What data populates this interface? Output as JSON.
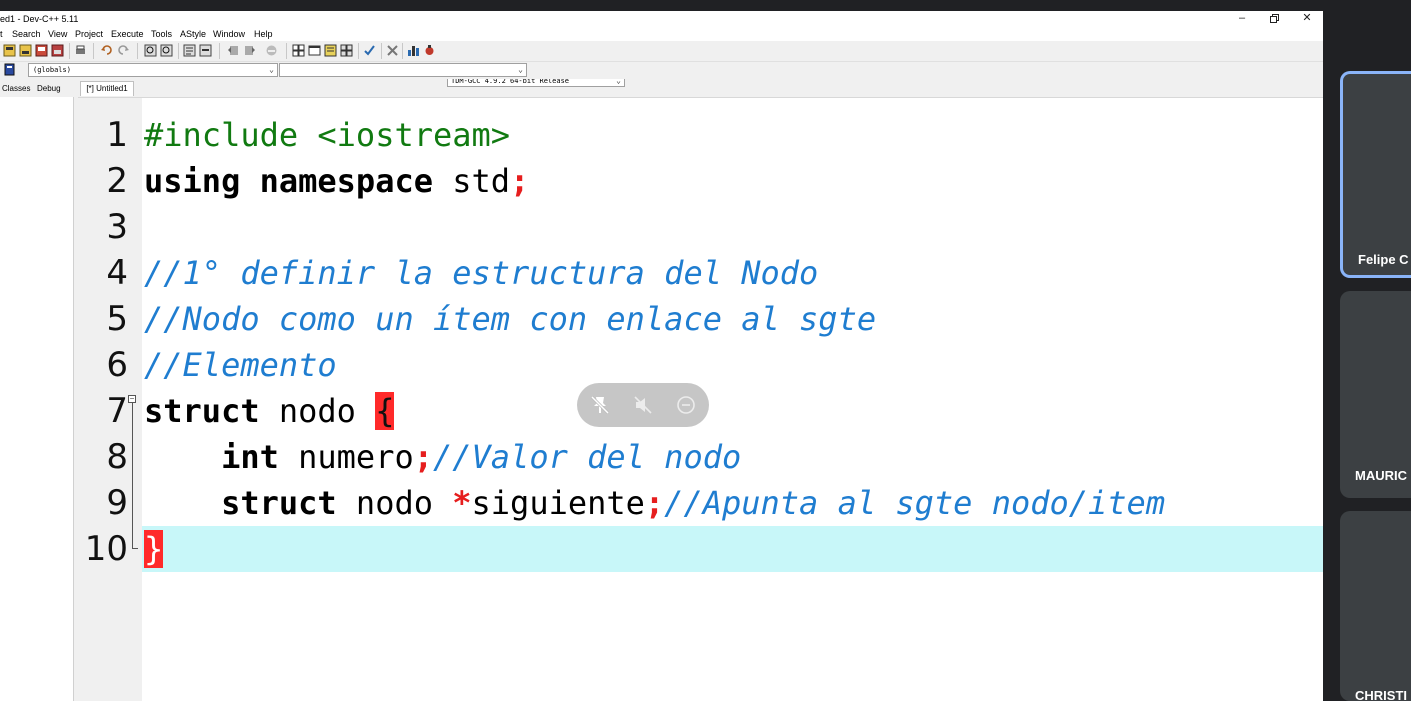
{
  "window": {
    "title": "ed1 - Dev-C++ 5.11"
  },
  "menu": [
    "t",
    "Search",
    "View",
    "Project",
    "Execute",
    "Tools",
    "AStyle",
    "Window",
    "Help"
  ],
  "toolbar": {
    "compiler": "TDM-GCC 4.9.2 64-bit Release",
    "scope_combo": "(globals)",
    "member_combo": ""
  },
  "panel_tabs": [
    "Classes",
    "Debug"
  ],
  "editor": {
    "tab_label": "[*] Untitled1",
    "line_numbers": [
      "1",
      "2",
      "3",
      "4",
      "5",
      "6",
      "7",
      "8",
      "9",
      "10"
    ],
    "lines": [
      [
        {
          "t": "#include <iostream>",
          "k": "pre"
        }
      ],
      [
        {
          "t": "using namespace",
          "k": "kw"
        },
        {
          "t": " std",
          "k": "txt"
        },
        {
          "t": ";",
          "k": "sym"
        }
      ],
      [],
      [
        {
          "t": "//1° definir la estructura del Nodo",
          "k": "cm"
        }
      ],
      [
        {
          "t": "//Nodo como un ítem con enlace al sgte",
          "k": "cm"
        }
      ],
      [
        {
          "t": "//Elemento",
          "k": "cm"
        }
      ],
      [
        {
          "t": "struct",
          "k": "kw"
        },
        {
          "t": " nodo ",
          "k": "txt"
        },
        {
          "t": "{",
          "k": "brace"
        }
      ],
      [
        {
          "t": "    int",
          "k": "kw"
        },
        {
          "t": " numero",
          "k": "txt"
        },
        {
          "t": ";",
          "k": "sym"
        },
        {
          "t": "//Valor del nodo",
          "k": "cm"
        }
      ],
      [
        {
          "t": "    struct",
          "k": "kw"
        },
        {
          "t": " nodo ",
          "k": "txt"
        },
        {
          "t": "*",
          "k": "sym"
        },
        {
          "t": "siguiente",
          "k": "txt"
        },
        {
          "t": ";",
          "k": "sym"
        },
        {
          "t": "//Apunta al sgte nodo/item",
          "k": "cm"
        }
      ],
      [
        {
          "t": "}",
          "k": "brace2"
        }
      ]
    ]
  },
  "meet": {
    "participants": [
      "Felipe C",
      "MAURIC",
      "CHRISTI"
    ]
  },
  "colors": {
    "current_line": "#c8f7f9",
    "comment": "#1f7dd0",
    "preprocessor": "#117a11",
    "symbol": "#e61e1e",
    "active_tile_border": "#8ab4f8"
  }
}
